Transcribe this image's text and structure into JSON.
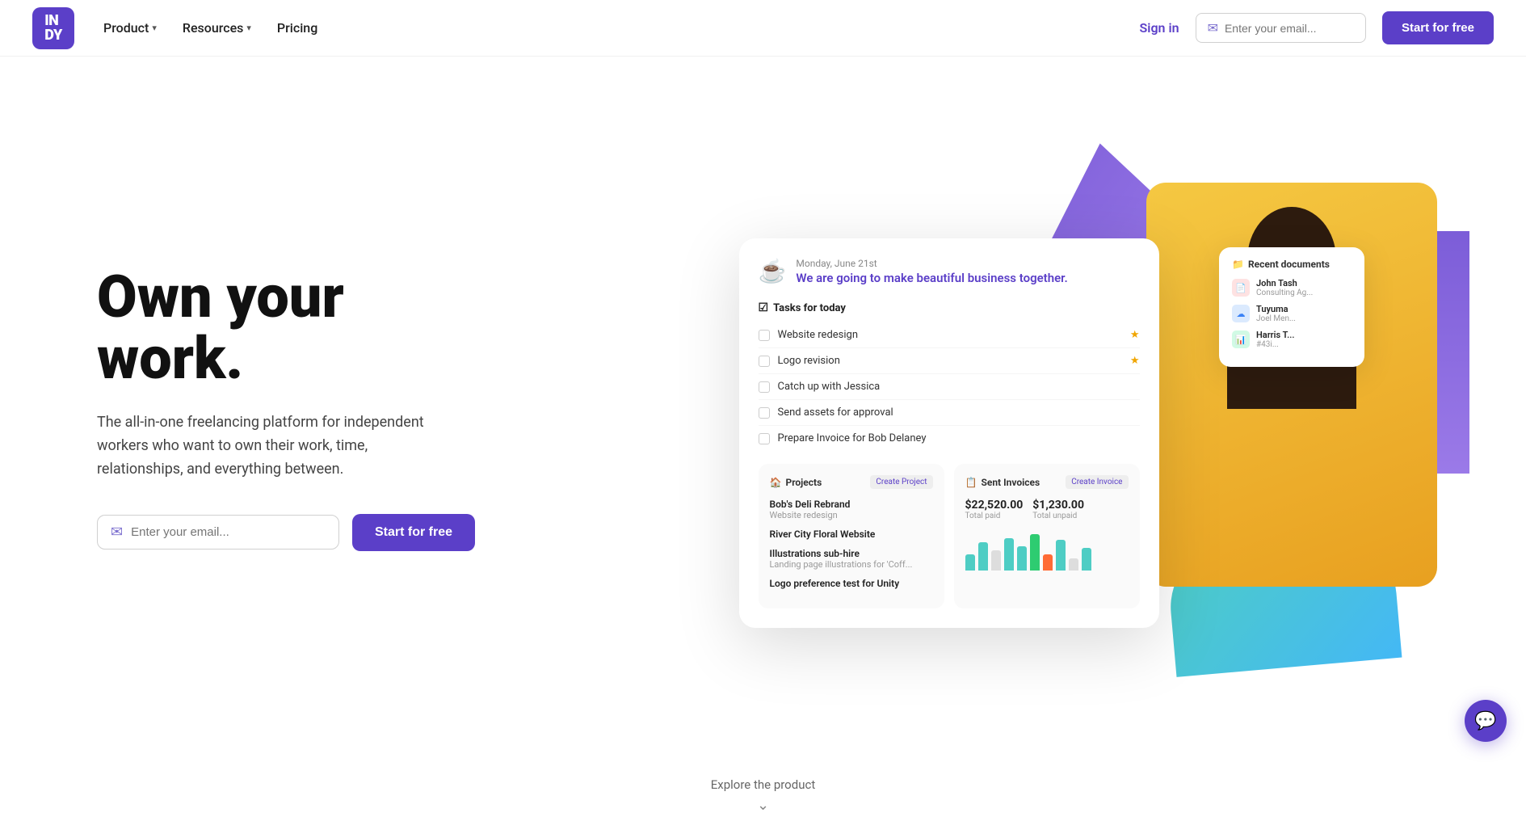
{
  "brand": {
    "logo_line1": "IN",
    "logo_line2": "DY"
  },
  "nav": {
    "product_label": "Product",
    "resources_label": "Resources",
    "pricing_label": "Pricing",
    "signin_label": "Sign in",
    "email_placeholder": "Enter your email...",
    "start_btn_label": "Start for free"
  },
  "hero": {
    "title": "Own your work.",
    "subtitle": "The all-in-one freelancing platform for independent workers who want to own their work, time, relationships, and everything between.",
    "email_placeholder": "Enter your email...",
    "start_btn_label": "Start for free"
  },
  "dashboard": {
    "date": "Monday, June 21st",
    "greeting": "We are going to make beautiful business together.",
    "tasks_label": "Tasks for today",
    "tasks": [
      {
        "name": "Website redesign",
        "starred": true
      },
      {
        "name": "Logo revision",
        "starred": true
      },
      {
        "name": "Catch up with Jessica",
        "starred": false
      },
      {
        "name": "Send assets for approval",
        "starred": false
      },
      {
        "name": "Prepare Invoice for Bob Delaney",
        "starred": false
      }
    ],
    "projects_label": "Projects",
    "create_project_btn": "Create Project",
    "projects": [
      {
        "name": "Bob's Deli Rebrand",
        "sub": "Website redesign"
      },
      {
        "name": "River City Floral Website",
        "sub": ""
      },
      {
        "name": "Illustrations sub-hire",
        "sub": "Landing page illustrations for 'Coff..."
      },
      {
        "name": "Logo preference test for Unity",
        "sub": ""
      }
    ],
    "invoices_label": "Sent Invoices",
    "create_invoice_btn": "Create Invoice",
    "total_paid": "$22,520.00",
    "total_paid_label": "Total paid",
    "total_unpaid": "$1,230.00",
    "total_unpaid_label": "Total unpaid",
    "recent_docs_label": "Recent documents",
    "docs": [
      {
        "name": "John Tash",
        "sub": "Consulting Ag...",
        "type": "red",
        "icon": "📄"
      },
      {
        "name": "Tuyuma",
        "sub": "Joel Men...",
        "type": "blue",
        "icon": "☁"
      },
      {
        "name": "Harris T...",
        "sub": "#43i...",
        "type": "green2",
        "icon": "📊"
      }
    ]
  },
  "explore": {
    "text": "Explore the product",
    "arrow": "⌄"
  },
  "chat": {
    "icon": "💬"
  }
}
